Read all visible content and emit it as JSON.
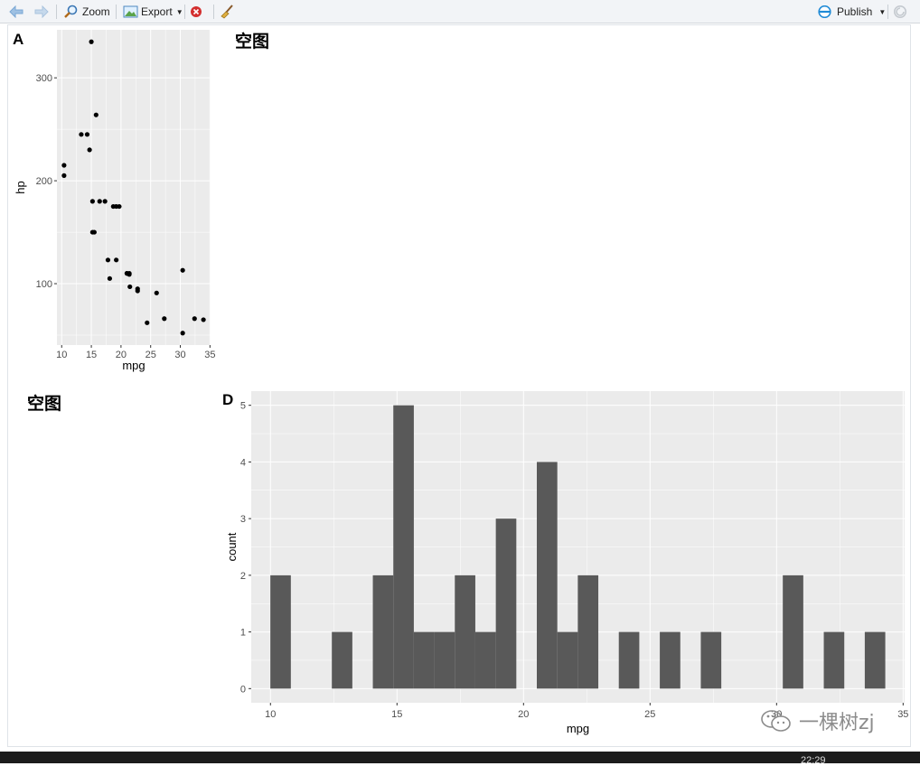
{
  "toolbar": {
    "zoom_label": "Zoom",
    "export_label": "Export",
    "publish_label": "Publish"
  },
  "status": {
    "clock": "22:29"
  },
  "watermark": {
    "text": "一棵树zj"
  },
  "panels": {
    "a_tag": "A",
    "b_empty": "空图",
    "c_empty": "空图",
    "d_tag": "D"
  },
  "colors": {
    "panel_bg": "#ebebeb",
    "grid": "#ffffff",
    "bar": "#595959",
    "point": "#000000"
  },
  "chart_data": [
    {
      "type": "scatter",
      "xlabel": "mpg",
      "ylabel": "hp",
      "xlim": [
        9.2,
        35.1
      ],
      "ylim": [
        40.35,
        346.65
      ],
      "x_ticks": [
        10,
        15,
        20,
        25,
        30,
        35
      ],
      "y_ticks": [
        100,
        200,
        300
      ],
      "points": [
        [
          21,
          110
        ],
        [
          21,
          110
        ],
        [
          22.8,
          93
        ],
        [
          21.4,
          110
        ],
        [
          18.7,
          175
        ],
        [
          18.1,
          105
        ],
        [
          14.3,
          245
        ],
        [
          24.4,
          62
        ],
        [
          22.8,
          95
        ],
        [
          19.2,
          123
        ],
        [
          17.8,
          123
        ],
        [
          16.4,
          180
        ],
        [
          17.3,
          180
        ],
        [
          15.2,
          180
        ],
        [
          10.4,
          205
        ],
        [
          10.4,
          215
        ],
        [
          14.7,
          230
        ],
        [
          32.4,
          66
        ],
        [
          30.4,
          52
        ],
        [
          33.9,
          65
        ],
        [
          21.5,
          97
        ],
        [
          15.5,
          150
        ],
        [
          15.2,
          150
        ],
        [
          13.3,
          245
        ],
        [
          19.2,
          175
        ],
        [
          27.3,
          66
        ],
        [
          26,
          91
        ],
        [
          30.4,
          113
        ],
        [
          15.8,
          264
        ],
        [
          19.7,
          175
        ],
        [
          15,
          335
        ],
        [
          21.4,
          109
        ]
      ],
      "grid": true
    },
    {
      "type": "bar",
      "xlabel": "mpg",
      "ylabel": "count",
      "xlim": [
        9.24,
        35.06
      ],
      "ylim": [
        -0.25,
        5.25
      ],
      "x_ticks": [
        10,
        15,
        20,
        25,
        30,
        35
      ],
      "y_ticks": [
        0,
        1,
        2,
        3,
        4,
        5
      ],
      "bin_width": 0.81,
      "bins": [
        {
          "x": 10.4,
          "count": 2
        },
        {
          "x": 11.21,
          "count": 0
        },
        {
          "x": 12.02,
          "count": 0
        },
        {
          "x": 12.83,
          "count": 1
        },
        {
          "x": 13.64,
          "count": 0
        },
        {
          "x": 14.45,
          "count": 2
        },
        {
          "x": 15.26,
          "count": 5
        },
        {
          "x": 16.07,
          "count": 1
        },
        {
          "x": 16.88,
          "count": 1
        },
        {
          "x": 17.69,
          "count": 2
        },
        {
          "x": 18.5,
          "count": 1
        },
        {
          "x": 19.31,
          "count": 3
        },
        {
          "x": 20.12,
          "count": 0
        },
        {
          "x": 20.93,
          "count": 4
        },
        {
          "x": 21.74,
          "count": 1
        },
        {
          "x": 22.55,
          "count": 2
        },
        {
          "x": 23.36,
          "count": 0
        },
        {
          "x": 24.17,
          "count": 1
        },
        {
          "x": 24.98,
          "count": 0
        },
        {
          "x": 25.79,
          "count": 1
        },
        {
          "x": 26.6,
          "count": 0
        },
        {
          "x": 27.41,
          "count": 1
        },
        {
          "x": 28.22,
          "count": 0
        },
        {
          "x": 29.03,
          "count": 0
        },
        {
          "x": 29.84,
          "count": 0
        },
        {
          "x": 30.65,
          "count": 2
        },
        {
          "x": 31.46,
          "count": 0
        },
        {
          "x": 32.27,
          "count": 1
        },
        {
          "x": 33.08,
          "count": 0
        },
        {
          "x": 33.89,
          "count": 1
        }
      ],
      "grid": true
    }
  ]
}
